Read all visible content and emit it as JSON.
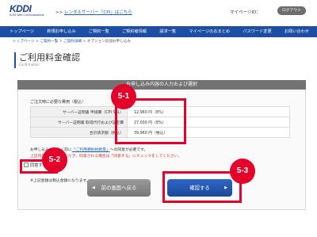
{
  "header": {
    "logo_mark": "KDDI",
    "logo_sub": "KDDI Web Communications",
    "notice_prefix": ">> ",
    "notice_link": "レンタルサーバー「CPI」はこちら",
    "mypage_label": "マイページID：",
    "logout_label": "ログアウト"
  },
  "nav": {
    "items": [
      "トップページ",
      "新規お申し込み",
      "ご契約一覧",
      "ご契約者情報",
      "請求一覧",
      "マイページのおまとめ",
      "パスワード変更",
      "お問い合わせ"
    ]
  },
  "breadcrumb": {
    "home": "トップページ",
    "sep1": " > ",
    "contracts": "ご契約一覧",
    "sep2": " > ",
    "detail": "ご契約詳細",
    "sep3": " > ",
    "current": "オプション追加お申し込み"
  },
  "page": {
    "title": "ご利用料金確認",
    "subtitle": "Confirmation"
  },
  "panel": {
    "heading": "お申し込み内容の入力および選択"
  },
  "fees": {
    "section_label": "ご注文時に必要な費用（税込）",
    "rows": [
      {
        "label": "サーバー証明書 申請費（CPI SSL）",
        "value": "12,960 円（8%）"
      },
      {
        "label": "サーバー証明書 取得代行および設定費",
        "value": "27,000 円（8%）"
      },
      {
        "label": "合計請求額（税込）",
        "value": "39,960 円（税込）"
      }
    ]
  },
  "notes": {
    "note1_prefix": "お申し込みいただく前に",
    "note1_link": "「ご利用規約約款等」",
    "note1_suffix": "への同意が必要です。",
    "note2": "上記内容をご確認いただき、同意される場合は「同意する」にチェックをしてください。",
    "note3": "※上記金額は税込金額になります。"
  },
  "agree": {
    "label": "同意する"
  },
  "buttons": {
    "back_arrow": "◀",
    "back": "前の画面へ戻る",
    "confirm": "確認する",
    "confirm_arrow": "▶"
  },
  "annotations": {
    "step1": "5-1",
    "step2": "5-2",
    "step3": "5-3",
    "highlight_color": "#e3002b"
  }
}
